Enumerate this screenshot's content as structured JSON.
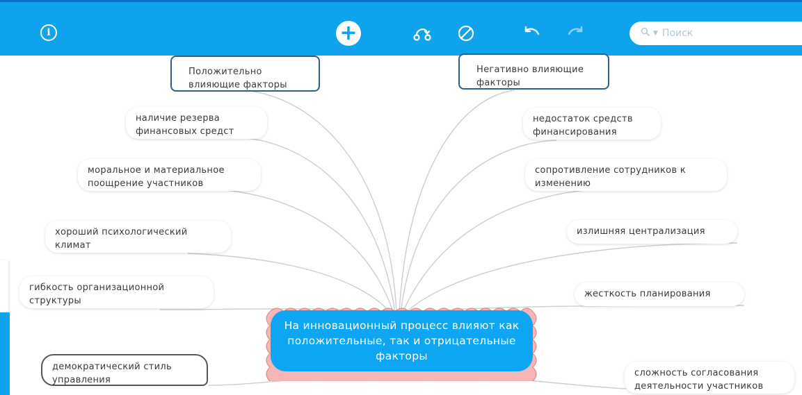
{
  "toolbar": {
    "info_glyph": "i",
    "add_glyph": "+",
    "icons": [
      "info-icon",
      "add-icon",
      "link-icon",
      "no-entry-icon",
      "undo-icon",
      "redo-icon",
      "search-icon"
    ],
    "search": {
      "placeholder": "Поиск"
    },
    "colors": {
      "bar": "#0fa3ee",
      "bar_top": "#0a6fc2",
      "center_node": "#0ea5f3",
      "center_frame": "#f2a8a8",
      "category_border": "#2c5f8e"
    }
  },
  "mindmap": {
    "center": "На инновационный процесс влияют как положительные, так и отрицательные факторы",
    "positive_heading": "Положительно влияющие факторы",
    "negative_heading": "Негативно влияющие факторы",
    "positive": [
      "наличие резерва финансовых средст",
      "моральное и материальное поощрение участников",
      "хороший психологический климат",
      "гибкость организационной структуры",
      "демократический стиль управления"
    ],
    "negative": [
      "недостаток средств финансирования",
      "сопротивление сотрудников к изменению",
      "излишняя централизация",
      "жесткость планирования",
      "сложность согласования деятельности участников"
    ]
  }
}
